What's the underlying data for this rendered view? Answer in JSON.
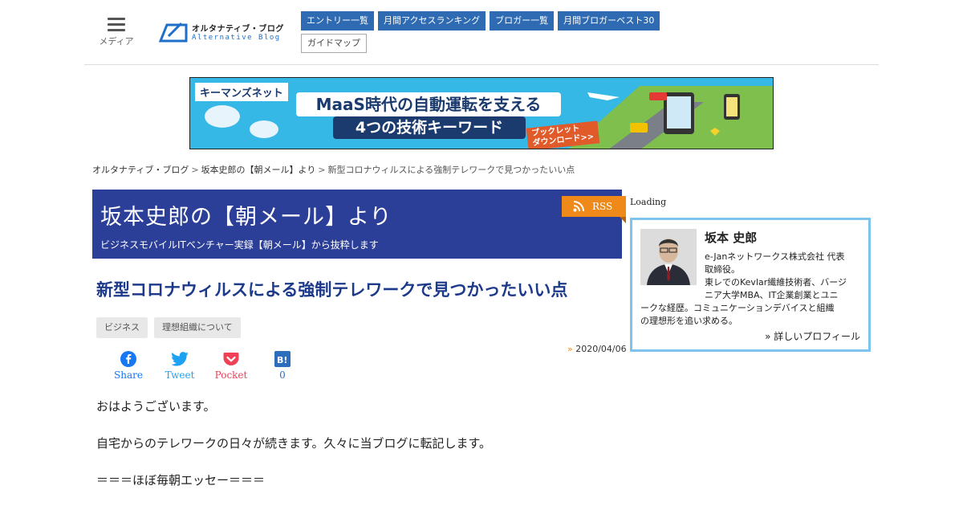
{
  "header": {
    "menu_label": "メディア",
    "logo_jp": "オルタナティブ・ブログ",
    "logo_en": "Alternative Blog",
    "nav_items": [
      "エントリー一覧",
      "月間アクセスランキング",
      "ブロガー一覧",
      "月間ブロガーベスト30"
    ],
    "nav_secondary": "ガイドマップ"
  },
  "banner": {
    "brand": "キーマンズネット",
    "headline": "MaaS時代の自動運転を支える",
    "subhead": "4つの技術キーワード",
    "cta_line1": "ブックレット",
    "cta_line2": "ダウンロード>>"
  },
  "breadcrumb": {
    "home": "オルタナティブ・ブログ",
    "sep": ">",
    "blog": "坂本史郎の【朝メール】より",
    "current": "新型コロナウィルスによる強制テレワークで見つかったいい点"
  },
  "blog": {
    "title": "坂本史郎の【朝メール】より",
    "subtitle": "ビジネスモバイルITベンチャー実録【朝メール】から抜粋します",
    "rss_label": "RSS"
  },
  "article": {
    "title": "新型コロナウィルスによる強制テレワークで見つかったいい点",
    "tags": [
      "ビジネス",
      "理想組織について"
    ],
    "date_marker": "»",
    "date": "2020/04/06",
    "shares": [
      {
        "label": "Share",
        "icon": "facebook-icon",
        "color": "#1877f2"
      },
      {
        "label": "Tweet",
        "icon": "twitter-icon",
        "color": "#1da1f2"
      },
      {
        "label": "Pocket",
        "icon": "pocket-icon",
        "color": "#ef4056"
      },
      {
        "label": "0",
        "icon": "hatena-bookmark-icon",
        "color": "#2c6ebd"
      }
    ],
    "paragraphs": [
      "おはようございます。",
      "自宅からのテレワークの日々が続きます。久々に当ブログに転記します。",
      "＝＝＝ほぼ毎朝エッセー＝＝＝"
    ]
  },
  "sidebar": {
    "loading": "Loading",
    "profile": {
      "name": "坂本 史郎",
      "line1": "e-Janネットワークス株式会社 代表",
      "line2": "取締役。",
      "line3": "東レでのKevlar繊維技術者、バージ",
      "line4": "ニア大学MBA、IT企業創業とユニ",
      "line5": "ークな経歴。コミュニケーションデバイスと組織",
      "line6": "の理想形を追い求める。",
      "more": "» 詳しいプロフィール"
    }
  },
  "colors": {
    "nav_blue": "#2f6bb2",
    "title_band": "#2c3f98",
    "article_title": "#1d3a8a",
    "rss_orange": "#ef8a1a",
    "profile_border": "#7ec3ee"
  }
}
